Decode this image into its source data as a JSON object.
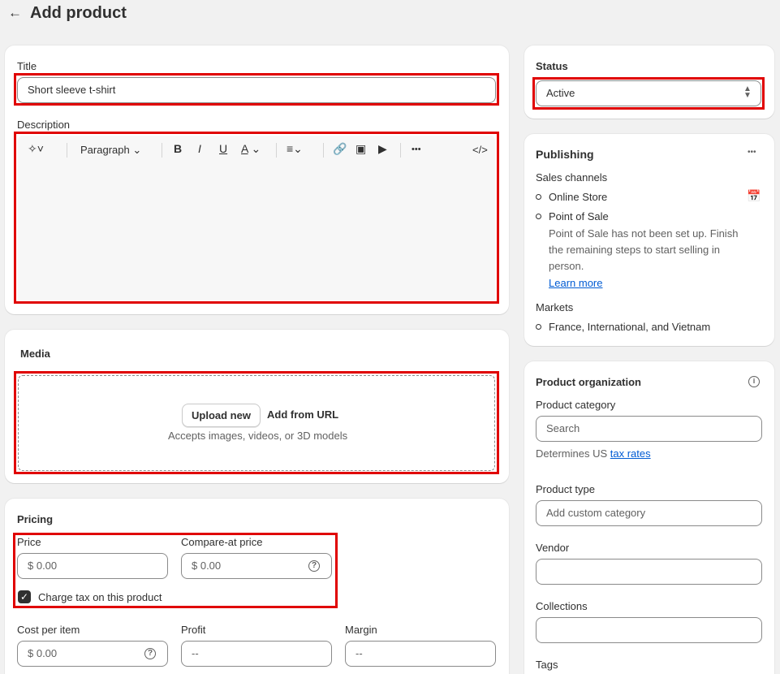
{
  "header": {
    "back_icon": "arrow-left-icon",
    "title": "Add product"
  },
  "general": {
    "title_label": "Title",
    "title_value": "Short sleeve t-shirt",
    "description_label": "Description",
    "toolbar": {
      "magic_icon": "sparkle-icon",
      "paragraph_label": "Paragraph",
      "bold": "B",
      "italic": "I",
      "underline": "U",
      "text_color": "A",
      "align_icon": "align-left-icon",
      "link_icon": "link-icon",
      "image_icon": "image-icon",
      "video_icon": "play-icon",
      "more": "•••",
      "code": "</>"
    }
  },
  "media": {
    "heading": "Media",
    "upload_button": "Upload new",
    "add_url_button": "Add from URL",
    "hint": "Accepts images, videos, or 3D models"
  },
  "pricing": {
    "heading": "Pricing",
    "price_label": "Price",
    "price_value": "$  0.00",
    "compare_label": "Compare-at price",
    "compare_value": "$  0.00",
    "tax_checkbox_label": "Charge tax on this product",
    "tax_checked": true,
    "cost_label": "Cost per item",
    "cost_value": "$  0.00",
    "profit_label": "Profit",
    "profit_value": "--",
    "margin_label": "Margin",
    "margin_value": "--"
  },
  "status": {
    "heading": "Status",
    "value": "Active"
  },
  "publishing": {
    "heading": "Publishing",
    "more": "•••",
    "channels_label": "Sales channels",
    "online_store": "Online Store",
    "point_of_sale": "Point of Sale",
    "pos_note_1": "Point of Sale has not been set up. Finish",
    "pos_note_2": "the remaining steps to start selling in",
    "pos_note_3": "person.",
    "learn_more": "Learn more",
    "markets_label": "Markets",
    "markets_value": "France, International, and Vietnam"
  },
  "organization": {
    "heading": "Product organization",
    "category_label": "Product category",
    "category_placeholder": "Search",
    "tax_note": "Determines US",
    "tax_link": "tax rates",
    "type_label": "Product type",
    "type_placeholder": "Add custom category",
    "vendor_label": "Vendor",
    "vendor_value": "",
    "collections_label": "Collections",
    "collections_value": "",
    "tags_label": "Tags"
  },
  "colors": {
    "highlight": "#e00000",
    "link": "#005bd3",
    "background": "#f1f1f1"
  }
}
